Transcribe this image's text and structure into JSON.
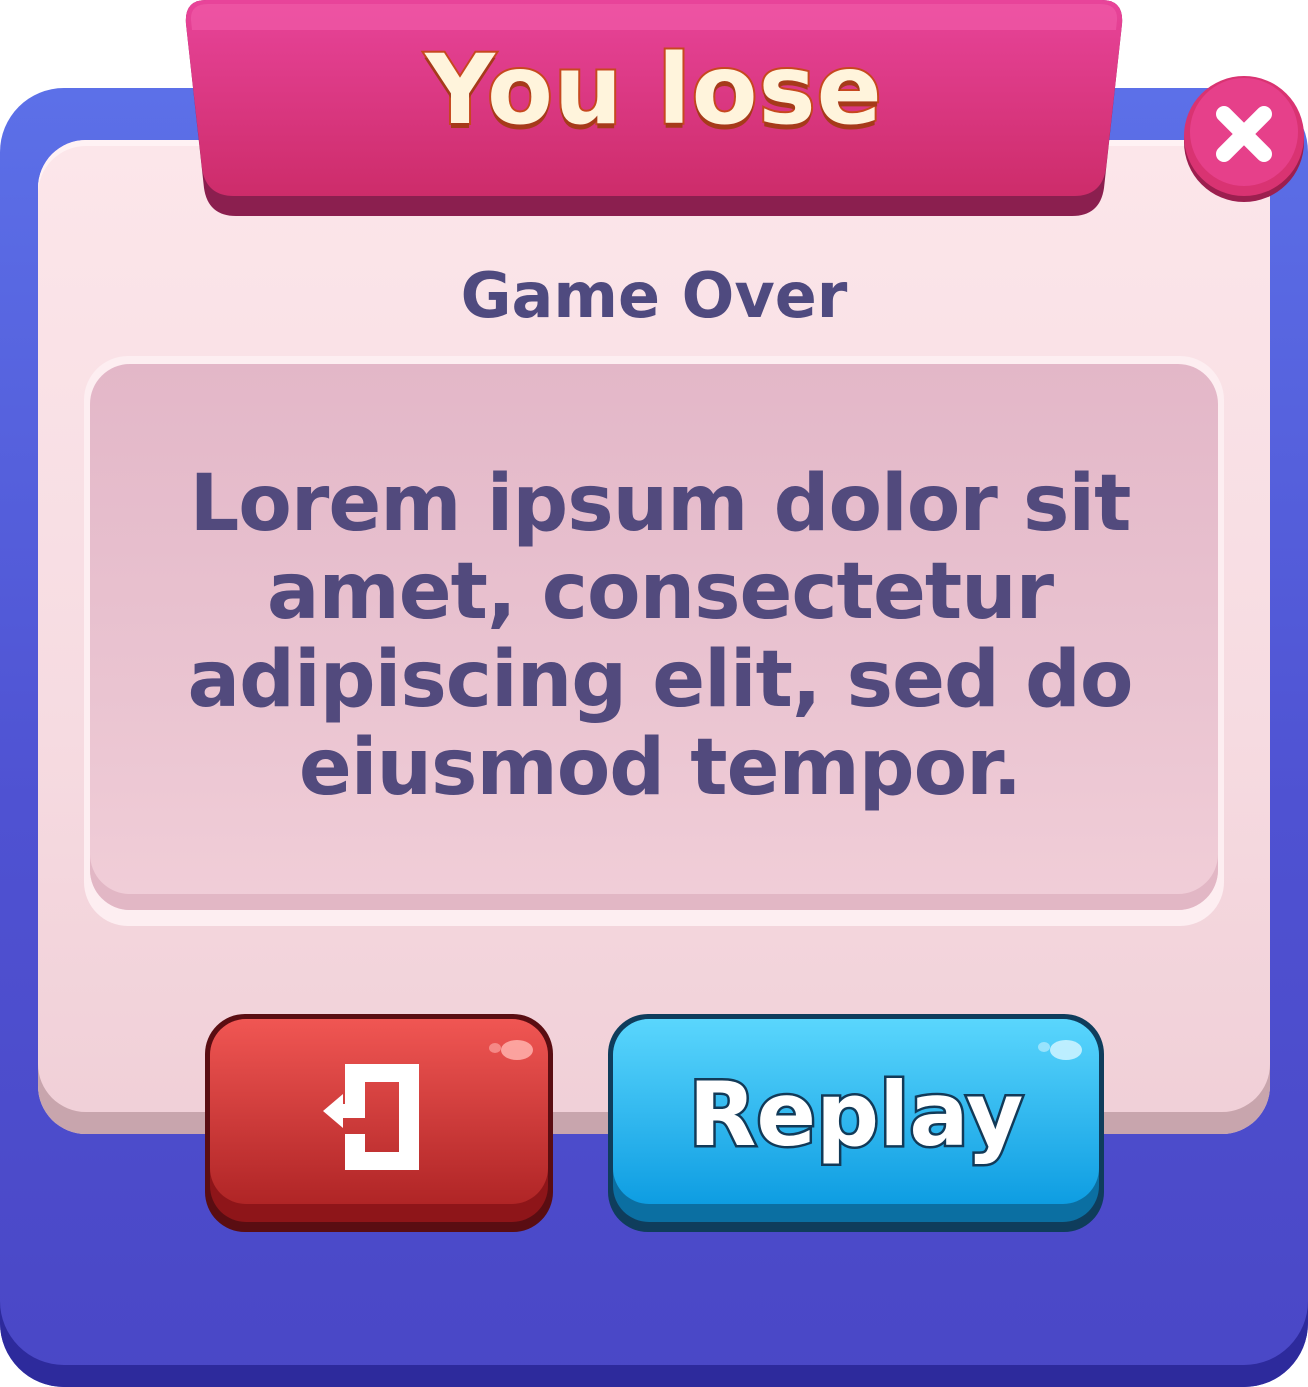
{
  "dialog": {
    "title": "You lose",
    "subtitle": "Game Over",
    "message": "Lorem ipsum dolor sit amet, consectetur adipiscing elit, sed do eiusmod tempor."
  },
  "buttons": {
    "exit_icon": "exit-door-icon",
    "replay_label": "Replay",
    "close_icon": "close-x-icon"
  },
  "colors": {
    "frame": "#4f52d2",
    "panel": "#f6dbe1",
    "ribbon": "#e0407f",
    "exit_button": "#e0433f",
    "replay_button": "#27b3ee",
    "text": "#524a7d"
  }
}
